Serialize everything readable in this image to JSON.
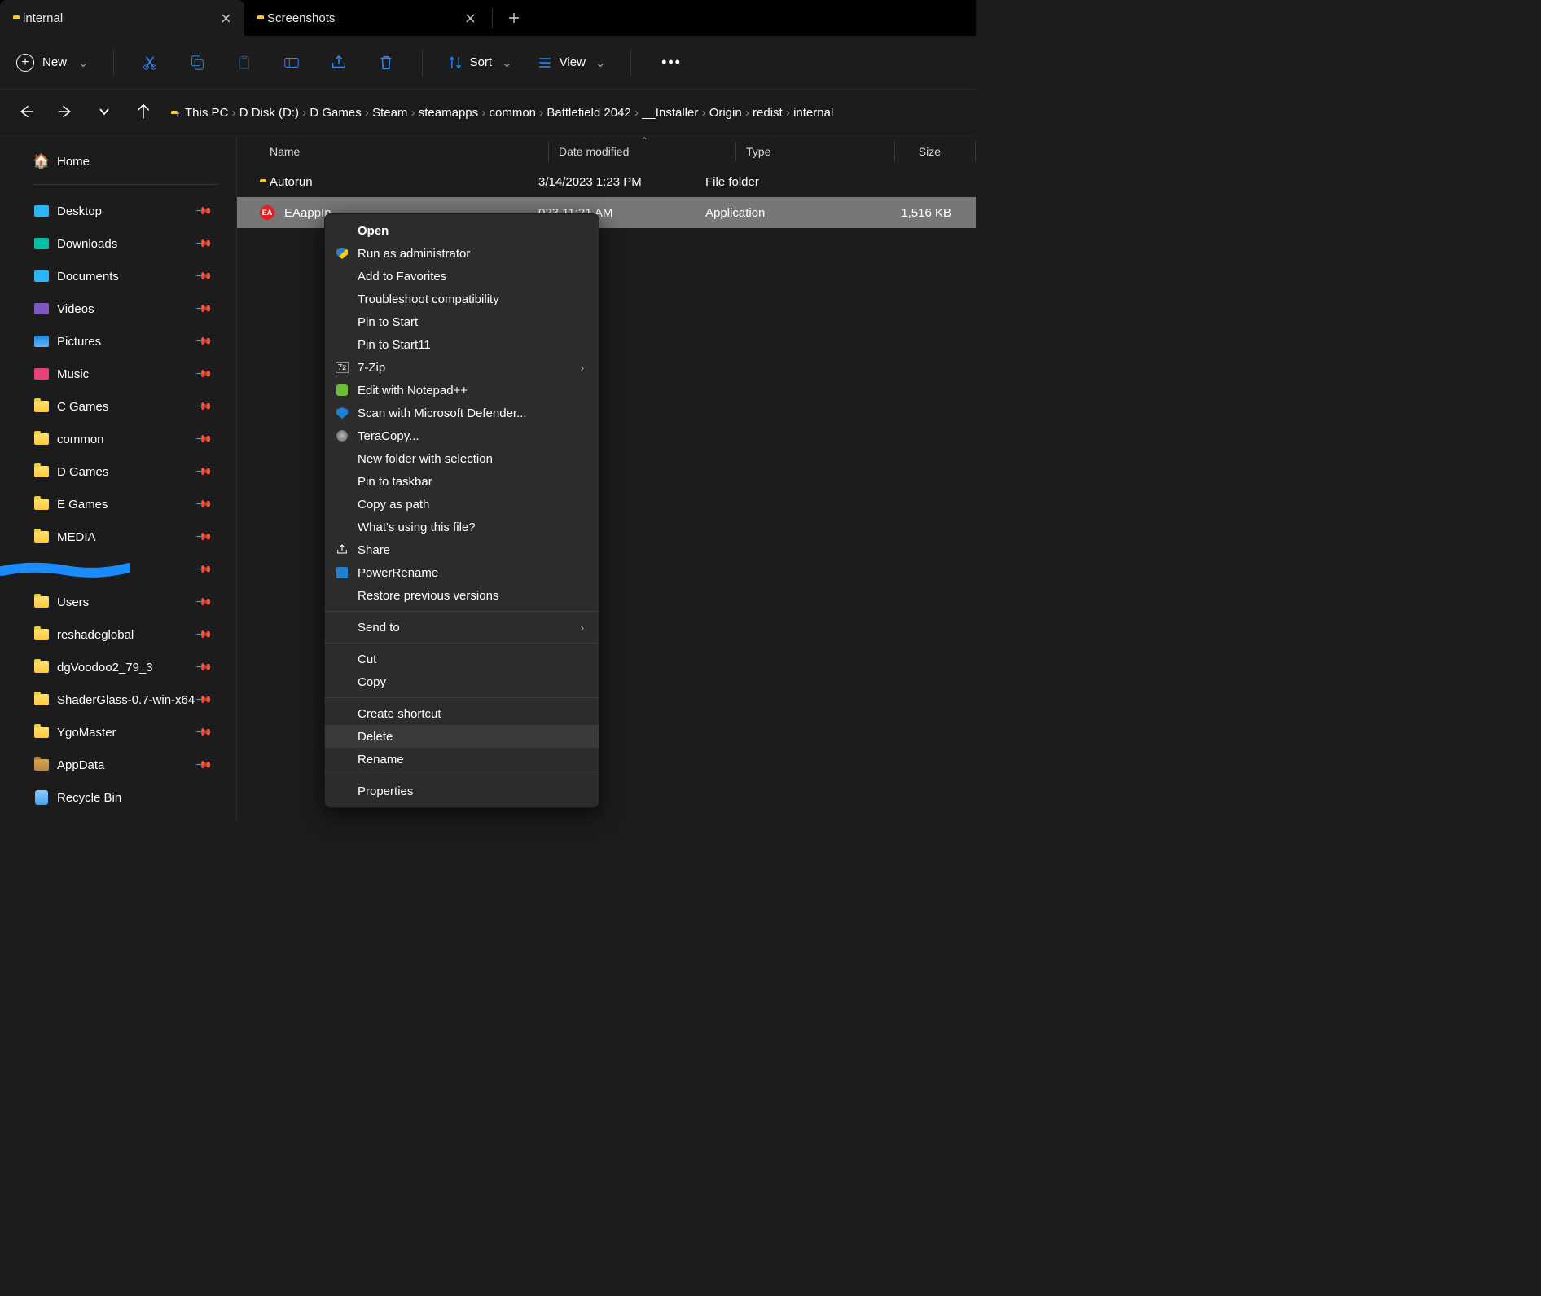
{
  "tabs": [
    {
      "title": "internal",
      "active": true
    },
    {
      "title": "Screenshots",
      "active": false
    }
  ],
  "toolbar": {
    "new": "New",
    "sort": "Sort",
    "view": "View"
  },
  "breadcrumb": [
    "This PC",
    "D Disk (D:)",
    "D Games",
    "Steam",
    "steamapps",
    "common",
    "Battlefield 2042",
    "__Installer",
    "Origin",
    "redist",
    "internal"
  ],
  "columns": {
    "name": "Name",
    "date": "Date modified",
    "type": "Type",
    "size": "Size"
  },
  "rows": [
    {
      "icon": "folder",
      "name": "Autorun",
      "date": "3/14/2023 1:23 PM",
      "type": "File folder",
      "size": "",
      "selected": false
    },
    {
      "icon": "ea",
      "name": "EAappIn",
      "date": "023 11:21 AM",
      "type": "Application",
      "size": "1,516 KB",
      "selected": true
    }
  ],
  "sidebar": {
    "home": "Home",
    "items": [
      {
        "icon": "blue",
        "label": "Desktop",
        "pinned": true
      },
      {
        "icon": "teal",
        "label": "Downloads",
        "pinned": true
      },
      {
        "icon": "blue",
        "label": "Documents",
        "pinned": true
      },
      {
        "icon": "purple",
        "label": "Videos",
        "pinned": true
      },
      {
        "icon": "pic",
        "label": "Pictures",
        "pinned": true
      },
      {
        "icon": "pink",
        "label": "Music",
        "pinned": true
      },
      {
        "icon": "folder",
        "label": "C Games",
        "pinned": true
      },
      {
        "icon": "folder",
        "label": "common",
        "pinned": true
      },
      {
        "icon": "folder",
        "label": "D Games",
        "pinned": true
      },
      {
        "icon": "folder",
        "label": "E Games",
        "pinned": true
      },
      {
        "icon": "folder",
        "label": "MEDIA",
        "pinned": true
      },
      {
        "icon": "redact",
        "label": "",
        "pinned": true
      },
      {
        "icon": "folder",
        "label": "Users",
        "pinned": true
      },
      {
        "icon": "folder",
        "label": "reshadeglobal",
        "pinned": true
      },
      {
        "icon": "folder",
        "label": "dgVoodoo2_79_3",
        "pinned": true
      },
      {
        "icon": "folder",
        "label": "ShaderGlass-0.7-win-x64",
        "pinned": true
      },
      {
        "icon": "folder",
        "label": "YgoMaster",
        "pinned": true
      },
      {
        "icon": "brown",
        "label": "AppData",
        "pinned": true
      },
      {
        "icon": "bin",
        "label": "Recycle Bin",
        "pinned": false
      }
    ]
  },
  "context_menu": [
    {
      "label": "Open",
      "icon": "",
      "bold": true
    },
    {
      "label": "Run as administrator",
      "icon": "shield"
    },
    {
      "label": "Add to Favorites",
      "icon": ""
    },
    {
      "label": "Troubleshoot compatibility",
      "icon": ""
    },
    {
      "label": "Pin to Start",
      "icon": ""
    },
    {
      "label": "Pin to Start11",
      "icon": ""
    },
    {
      "label": "7-Zip",
      "icon": "7z",
      "submenu": true
    },
    {
      "label": "Edit with Notepad++",
      "icon": "npp"
    },
    {
      "label": "Scan with Microsoft Defender...",
      "icon": "defender"
    },
    {
      "label": "TeraCopy...",
      "icon": "tera"
    },
    {
      "label": "New folder with selection",
      "icon": ""
    },
    {
      "label": "Pin to taskbar",
      "icon": ""
    },
    {
      "label": "Copy as path",
      "icon": ""
    },
    {
      "label": "What's using this file?",
      "icon": ""
    },
    {
      "label": "Share",
      "icon": "share"
    },
    {
      "label": "PowerRename",
      "icon": "pr"
    },
    {
      "label": "Restore previous versions",
      "icon": ""
    },
    {
      "sep": true
    },
    {
      "label": "Send to",
      "icon": "",
      "submenu": true
    },
    {
      "sep": true
    },
    {
      "label": "Cut",
      "icon": ""
    },
    {
      "label": "Copy",
      "icon": ""
    },
    {
      "sep": true
    },
    {
      "label": "Create shortcut",
      "icon": ""
    },
    {
      "label": "Delete",
      "icon": "",
      "hover": true
    },
    {
      "label": "Rename",
      "icon": ""
    },
    {
      "sep": true
    },
    {
      "label": "Properties",
      "icon": ""
    }
  ]
}
